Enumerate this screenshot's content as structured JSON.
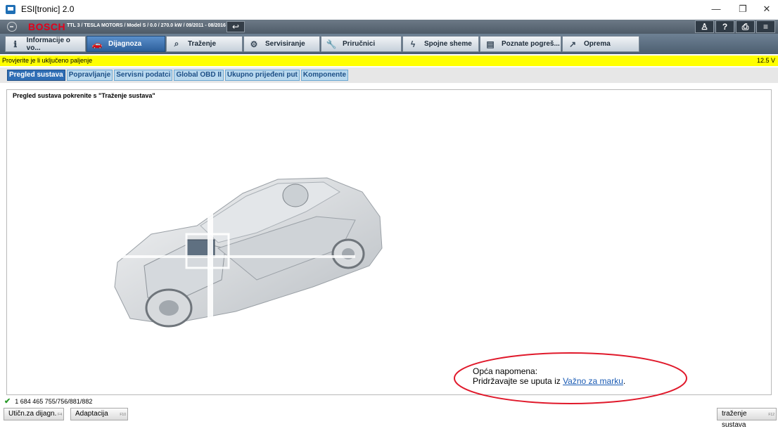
{
  "window": {
    "title": "ESI[tronic] 2.0",
    "controls": {
      "minimize": "—",
      "restore": "❐",
      "close": "✕"
    }
  },
  "header": {
    "brand": "BOSCH",
    "vehicle": "TTL 3 / TESLA MOTORS / Model S / 0.0 / 270.0 kW / 09/2011 - 08/2016",
    "back_icon": "↩",
    "icons": [
      {
        "name": "user-icon",
        "glyph": "♙"
      },
      {
        "name": "help-icon",
        "glyph": "?"
      },
      {
        "name": "print-icon",
        "glyph": "⎙"
      },
      {
        "name": "menu-icon",
        "glyph": "≡"
      }
    ],
    "brand_color": "#e2001a"
  },
  "tabs": [
    {
      "label": "Informacije o vo...",
      "icon": "info-icon",
      "glyph": "ℹ"
    },
    {
      "label": "Dijagnoza",
      "icon": "car-icon",
      "glyph": "🚗"
    },
    {
      "label": "Traženje",
      "icon": "search-icon",
      "glyph": "⌕"
    },
    {
      "label": "Servisiranje",
      "icon": "gears-icon",
      "glyph": "⚙"
    },
    {
      "label": "Priručnici",
      "icon": "wrench-icon",
      "glyph": "🔧"
    },
    {
      "label": "Spojne sheme",
      "icon": "lightning-icon",
      "glyph": "ϟ"
    },
    {
      "label": "Poznate pogreš...",
      "icon": "book-icon",
      "glyph": "▤"
    },
    {
      "label": "Oprema",
      "icon": "external-icon",
      "glyph": "↗"
    }
  ],
  "notice": {
    "text": "Provjerite je li uključeno paljenje",
    "voltage": "12.5 V"
  },
  "subtabs": [
    "Pregled sustava",
    "Popravljanje",
    "Servisni podatci",
    "Global OBD II",
    "Ukupno prijeđeni put",
    "Komponente"
  ],
  "content": {
    "title": "Pregled sustava pokrenite s \"Traženje sustava\""
  },
  "note": {
    "line1": "Opća napomena:",
    "line2_prefix": "Pridržavajte se uputa iz ",
    "link": "Važno za marku",
    "line2_suffix": "."
  },
  "status": {
    "check_glyph": "✔",
    "text": "1 684 465 755/756/881/882"
  },
  "footer": {
    "buttons": [
      {
        "label": "Utičn.za dijagn.",
        "key": "F4"
      },
      {
        "label": "Adaptacija",
        "key": "F10"
      }
    ],
    "right_button": "traženje sustava",
    "right_key": "F12"
  }
}
